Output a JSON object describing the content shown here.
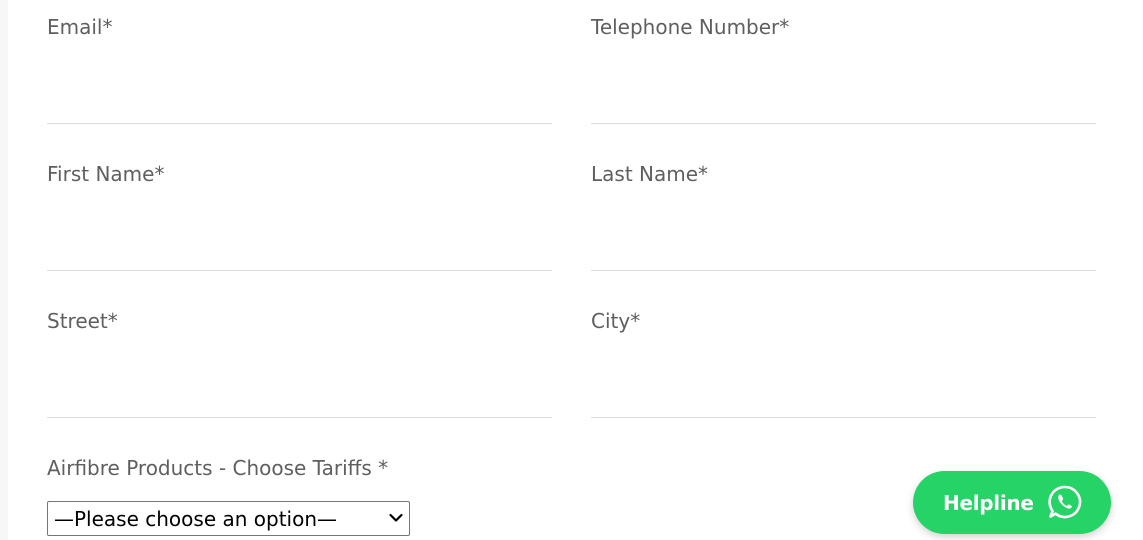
{
  "form": {
    "email": {
      "label": "Email*",
      "value": ""
    },
    "telephone": {
      "label": "Telephone Number*",
      "value": ""
    },
    "first_name": {
      "label": "First Name*",
      "value": ""
    },
    "last_name": {
      "label": "Last Name*",
      "value": ""
    },
    "street": {
      "label": "Street*",
      "value": ""
    },
    "city": {
      "label": "City*",
      "value": ""
    },
    "tariff": {
      "label": "Airfibre Products - Choose Tariffs *",
      "selected": "—Please choose an option—"
    }
  },
  "helpline": {
    "label": "Helpline",
    "icon": "whatsapp-icon",
    "color": "#25d366"
  }
}
